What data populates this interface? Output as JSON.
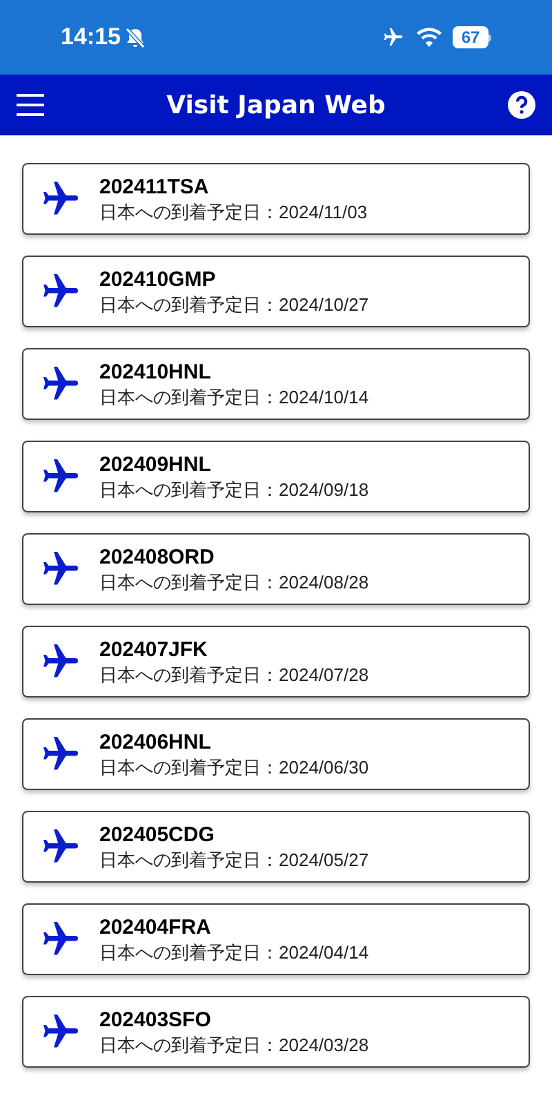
{
  "status_bar": {
    "time": "14:15",
    "battery": "67"
  },
  "header": {
    "title": "Visit Japan Web"
  },
  "trips": [
    {
      "code": "202411TSA",
      "arrival": "日本への到着予定日：2024/11/03"
    },
    {
      "code": "202410GMP",
      "arrival": "日本への到着予定日：2024/10/27"
    },
    {
      "code": "202410HNL",
      "arrival": "日本への到着予定日：2024/10/14"
    },
    {
      "code": "202409HNL",
      "arrival": "日本への到着予定日：2024/09/18"
    },
    {
      "code": "202408ORD",
      "arrival": "日本への到着予定日：2024/08/28"
    },
    {
      "code": "202407JFK",
      "arrival": "日本への到着予定日：2024/07/28"
    },
    {
      "code": "202406HNL",
      "arrival": "日本への到着予定日：2024/06/30"
    },
    {
      "code": "202405CDG",
      "arrival": "日本への到着予定日：2024/05/27"
    },
    {
      "code": "202404FRA",
      "arrival": "日本への到着予定日：2024/04/14"
    },
    {
      "code": "202403SFO",
      "arrival": "日本への到着予定日：2024/03/28"
    }
  ]
}
